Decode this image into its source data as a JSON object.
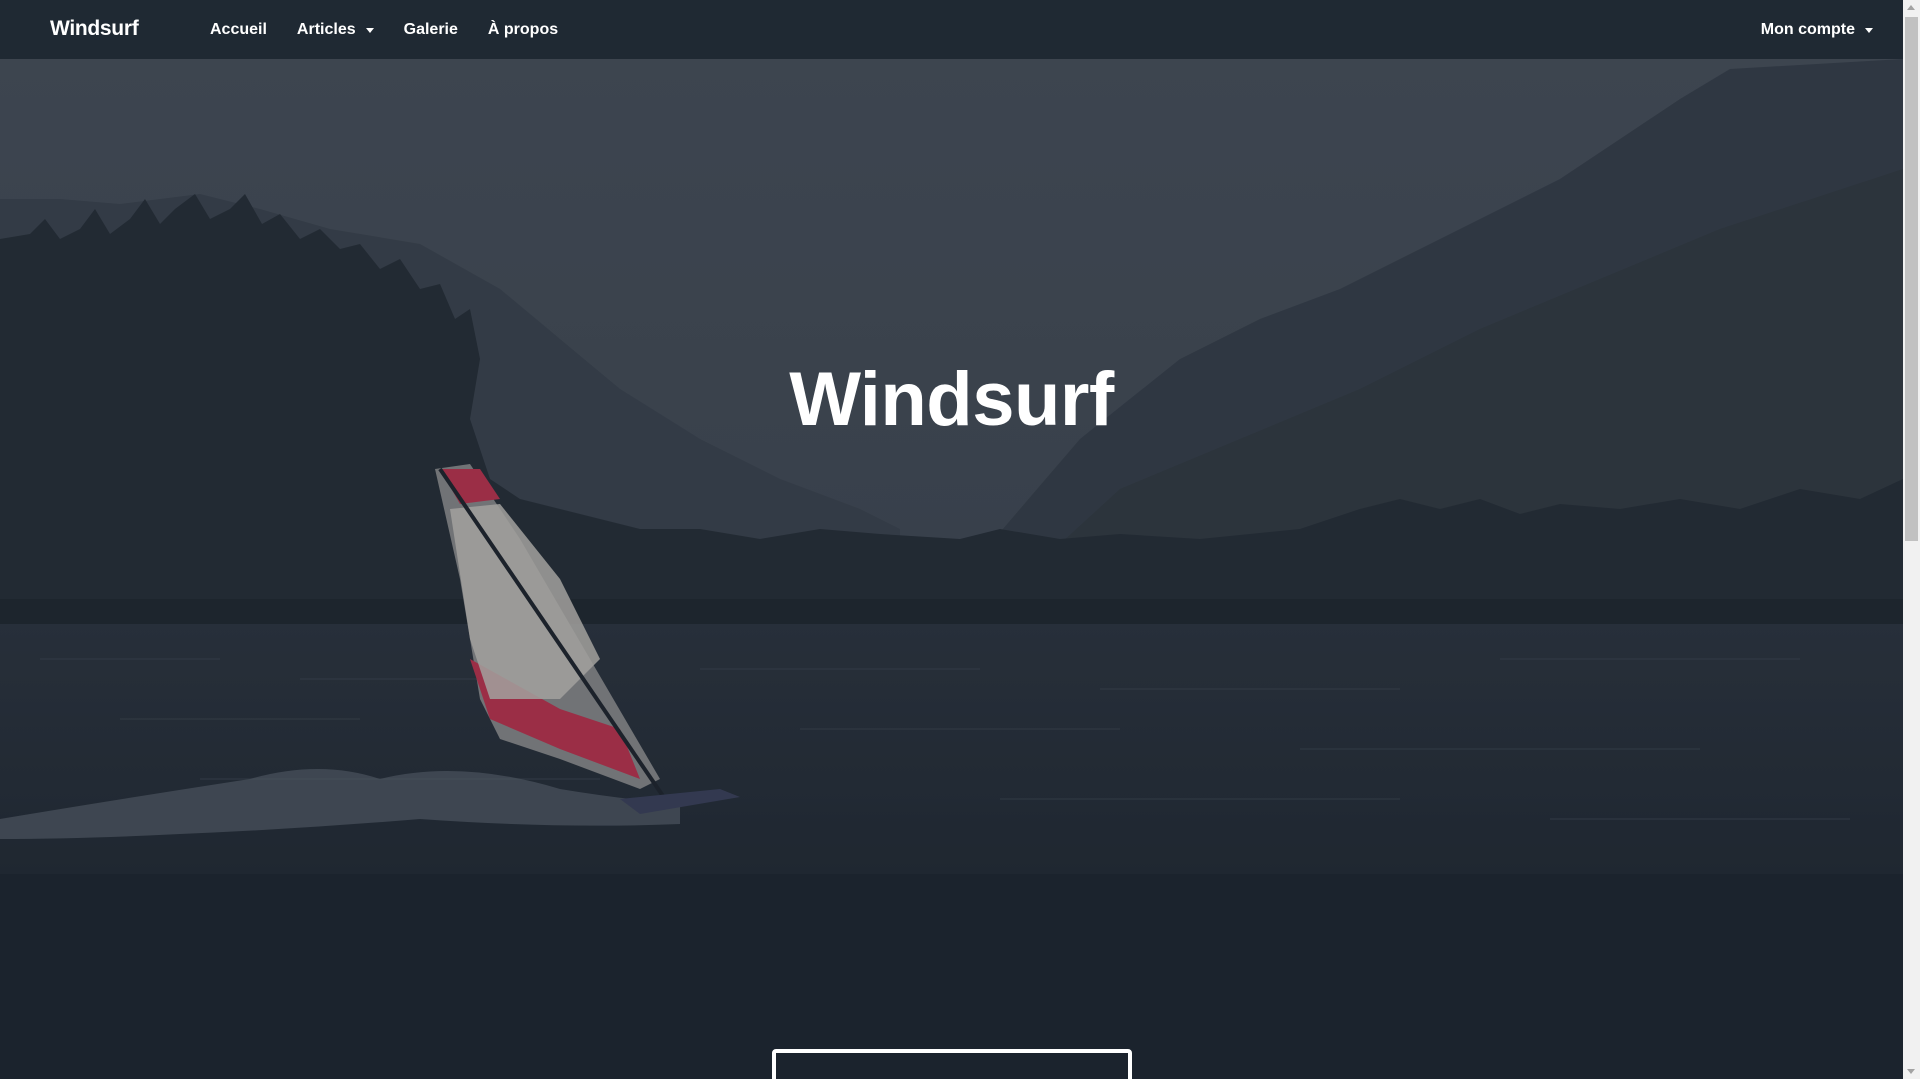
{
  "navbar": {
    "brand": "Windsurf",
    "links": [
      {
        "label": "Accueil",
        "dropdown": false
      },
      {
        "label": "Articles",
        "dropdown": true
      },
      {
        "label": "Galerie",
        "dropdown": false
      },
      {
        "label": "À propos",
        "dropdown": false
      }
    ],
    "account_label": "Mon compte"
  },
  "hero": {
    "title": "Windsurf"
  },
  "colors": {
    "navbar_bg": "#1f2933",
    "page_bg": "#1b232d",
    "text": "#ffffff",
    "sail_red": "#c4304d",
    "sail_white": "#e8e4dc"
  },
  "icons": {
    "caret": "chevron-down-icon"
  }
}
